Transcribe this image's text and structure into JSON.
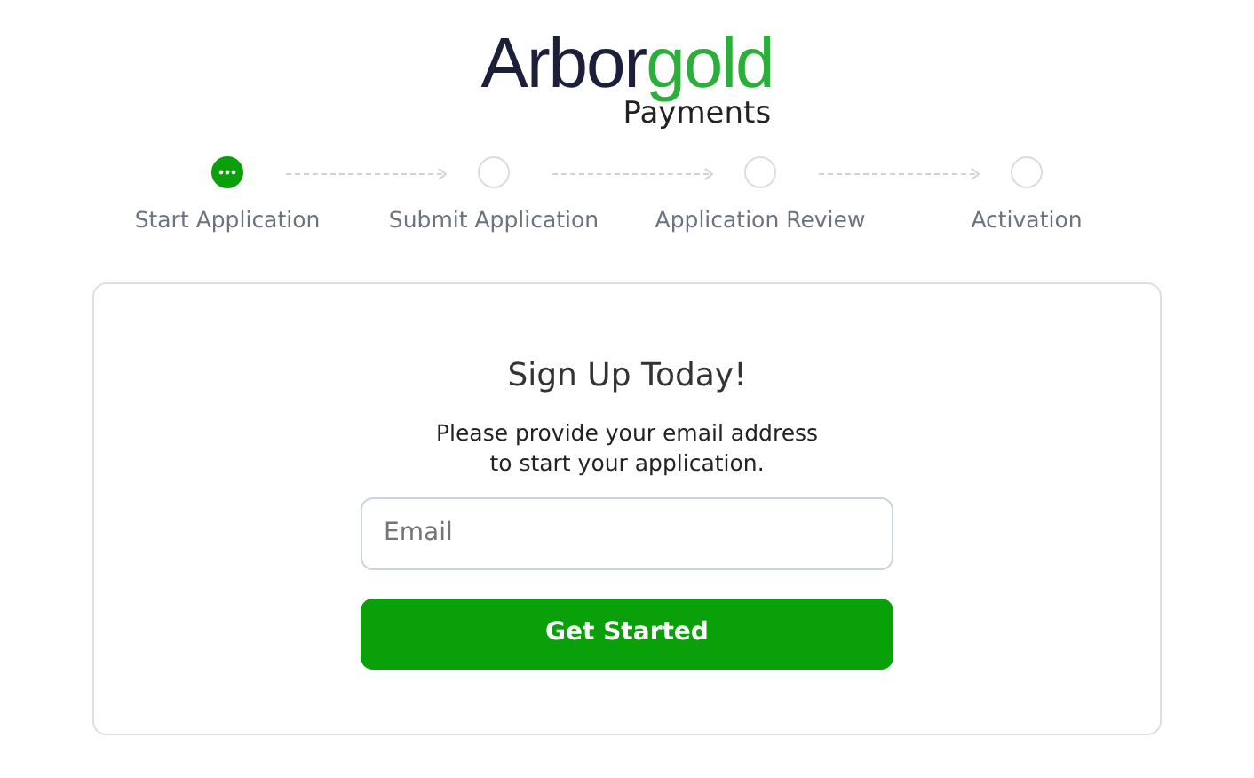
{
  "logo": {
    "dark": "Arbor",
    "accent": "gold",
    "subtitle": "Payments"
  },
  "steps": [
    {
      "label": "Start Application",
      "selected": true
    },
    {
      "label": "Submit Application",
      "selected": false
    },
    {
      "label": "Application Review",
      "selected": false
    },
    {
      "label": "Activation",
      "selected": false
    }
  ],
  "form": {
    "title": "Sign Up Today!",
    "text_lines": [
      "Please provide your email address",
      "to start your application."
    ],
    "email": {
      "placeholder": "Email"
    },
    "button": "Get Started"
  }
}
